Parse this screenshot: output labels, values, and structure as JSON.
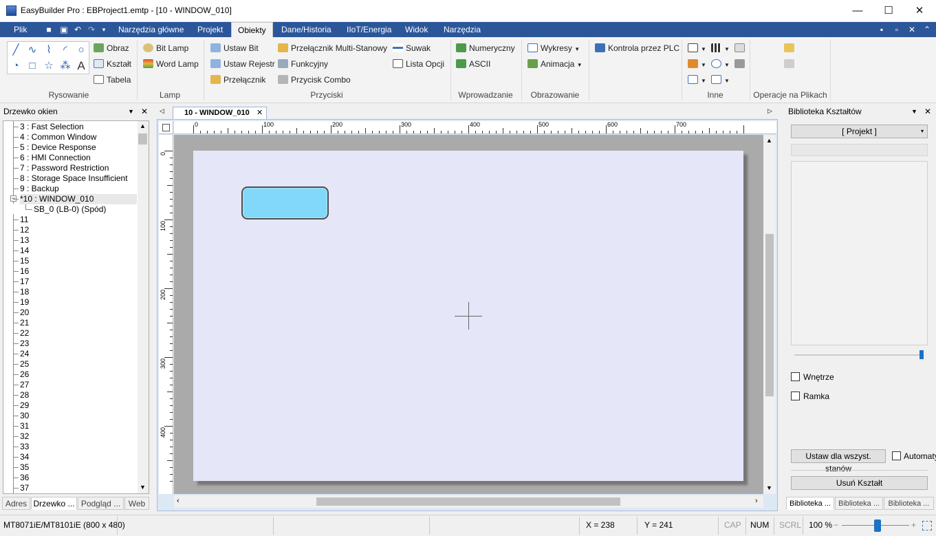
{
  "window": {
    "title": "EasyBuilder Pro : EBProject1.emtp - [10 - WINDOW_010]",
    "min": "—",
    "max": "☐",
    "close": "✕"
  },
  "menu": {
    "file": "Plik",
    "tabs": [
      "Narzędzia główne",
      "Projekt",
      "Obiekty",
      "Dane/Historia",
      "IIoT/Energia",
      "Widok",
      "Narzędzia"
    ],
    "active_tab": "Obiekty"
  },
  "ribbon": {
    "rysowanie": {
      "label": "Rysowanie",
      "items": [
        "Obraz",
        "Kształt",
        "Tabela"
      ]
    },
    "lamp": {
      "label": "Lamp",
      "items": [
        "Bit Lamp",
        "Word Lamp"
      ]
    },
    "przyciski": {
      "label": "Przyciski",
      "items": [
        "Ustaw Bit",
        "Ustaw Rejestr",
        "Przełącznik",
        "Przełącznik Multi-Stanowy",
        "Funkcyjny",
        "Przycisk Combo",
        "Suwak",
        "Lista Opcji"
      ]
    },
    "wprowadzanie": {
      "label": "Wprowadzanie",
      "items": [
        "Numeryczny",
        "ASCII"
      ]
    },
    "obrazowanie": {
      "label": "Obrazowanie",
      "items": [
        "Wykresy",
        "Animacja"
      ]
    },
    "plc": {
      "items": [
        "Kontrola przez PLC"
      ]
    },
    "inne": {
      "label": "Inne"
    },
    "operacje": {
      "label": "Operacje na Plikach"
    }
  },
  "left_panel": {
    "title": "Drzewko okien",
    "items": [
      "3 : Fast Selection",
      "4 : Common Window",
      "5 : Device Response",
      "6 : HMI Connection",
      "7 : Password Restriction",
      "8 : Storage Space Insufficient",
      "9 : Backup",
      "*10 : WINDOW_010",
      "SB_0 (LB-0) (Spód)",
      "11",
      "12",
      "13",
      "14",
      "15",
      "16",
      "17",
      "18",
      "19",
      "20",
      "21",
      "22",
      "23",
      "24",
      "25",
      "26",
      "27",
      "28",
      "29",
      "30",
      "31",
      "32",
      "33",
      "34",
      "35",
      "36",
      "37"
    ],
    "tabs": [
      "Adres",
      "Drzewko ...",
      "Podgląd ...",
      "Web"
    ]
  },
  "document": {
    "tab": "10 - WINDOW_010",
    "ruler_h": [
      "0",
      "100",
      "200",
      "300",
      "400",
      "500",
      "600",
      "700"
    ],
    "ruler_v": [
      "0",
      "100",
      "200",
      "300",
      "400"
    ]
  },
  "right_panel": {
    "title": "Biblioteka Kształtów",
    "dropdown": "[ Projekt ]",
    "checkboxes": [
      "Wnętrze",
      "Ramka"
    ],
    "set_all": "Ustaw dla wszyst. stanów",
    "auto": "Automaty",
    "remove": "Usuń Kształt",
    "tabs": [
      "Biblioteka ...",
      "Biblioteka ...",
      "Biblioteka ..."
    ]
  },
  "status": {
    "model": "MT8071iE/MT8101iE (800 x 480)",
    "x": "X = 238",
    "y": "Y = 241",
    "cap": "CAP",
    "num": "NUM",
    "scrl": "SCRL",
    "zoom": "100 %"
  },
  "colors": {
    "menu_bg": "#2b579a",
    "canvas": "#e6e6f9",
    "shape_fill": "#82d8fa"
  }
}
